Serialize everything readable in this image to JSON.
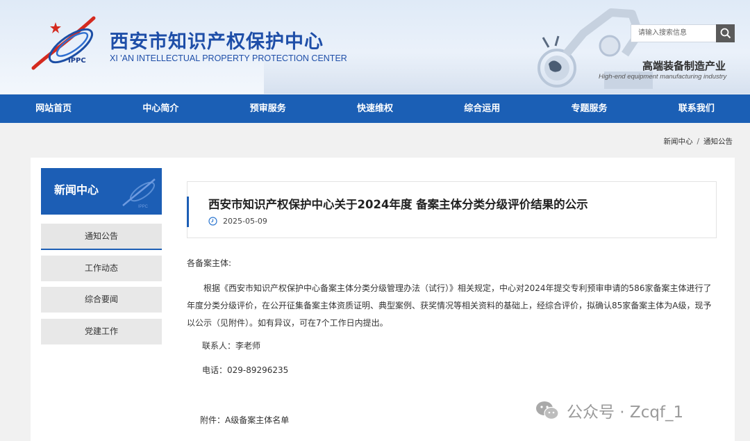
{
  "header": {
    "logo_text": "IPPC",
    "title_cn": "西安市知识产权保护中心",
    "title_en": "XI 'AN INTELLECTUAL PROPERTY PROTECTION CENTER",
    "search_placeholder": "请输入搜索信息",
    "slogan_cn": "高端装备制造产业",
    "slogan_en": "High-end equipment manufacturing industry",
    "brand_color": "#1b5fb5"
  },
  "nav": {
    "items": [
      "网站首页",
      "中心简介",
      "预审服务",
      "快速维权",
      "综合运用",
      "专题服务",
      "联系我们"
    ]
  },
  "breadcrumb": {
    "level1": "新闻中心",
    "separator": "/",
    "level2": "通知公告"
  },
  "sidebar": {
    "title": "新闻中心",
    "logo_text": "IPPC",
    "items": [
      "通知公告",
      "工作动态",
      "综合要闻",
      "党建工作"
    ],
    "active_index": 0
  },
  "article": {
    "title": "西安市知识产权保护中心关于2024年度 备案主体分类分级评价结果的公示",
    "date": "2025-05-09",
    "salutation": "各备案主体:",
    "paragraph": "根据《西安市知识产权保护中心备案主体分类分级管理办法（试行）》相关规定，中心对2024年提交专利预审申请的586家备案主体进行了年度分类分级评价，在公开征集备案主体资质证明、典型案例、获奖情况等相关资料的基础上，经综合评价，拟确认85家备案主体为A级，现予以公示（见附件）。如有异议，可在7个工作日内提出。",
    "contact": "联系人：李老师",
    "phone": "电话：029-89296235",
    "attachment_label": "附件：",
    "attachment_link": "A级备案主体名单"
  },
  "watermark": {
    "text": "公众号 · Zcqf_1",
    "icon": "wechat-icon"
  }
}
